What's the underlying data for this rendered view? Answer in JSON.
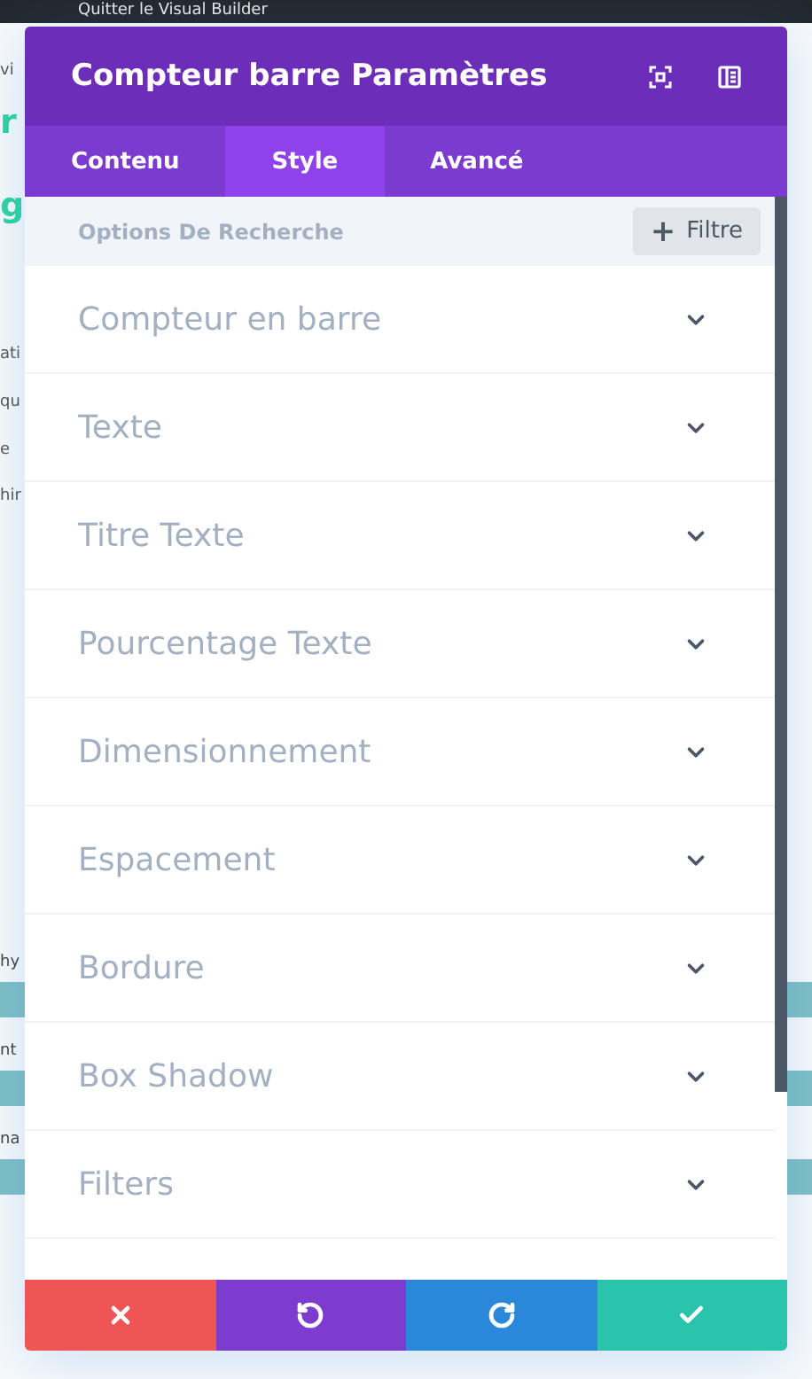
{
  "top_bar": {
    "label": "Quitter le Visual Builder"
  },
  "background": {
    "fragments": [
      {
        "text": "vi",
        "kind": "plain"
      },
      {
        "text": "r",
        "kind": "heading"
      },
      {
        "text": "g",
        "kind": "heading"
      },
      {
        "text": "ati",
        "kind": "plain"
      },
      {
        "text": "qu",
        "kind": "plain"
      },
      {
        "text": "e",
        "kind": "plain"
      },
      {
        "text": "hir",
        "kind": "plain"
      },
      {
        "text": "hy",
        "kind": "bar_label"
      },
      {
        "text": "nt",
        "kind": "bar_label"
      },
      {
        "text": "na",
        "kind": "bar_label"
      }
    ],
    "bars": [
      {
        "level": 1
      },
      {
        "level": 1
      },
      {
        "level": 1
      }
    ]
  },
  "panel": {
    "title": "Compteur barre Paramètres",
    "tabs": [
      {
        "label": "Contenu",
        "selected": false
      },
      {
        "label": "Style",
        "selected": true
      },
      {
        "label": "Avancé",
        "selected": false
      }
    ],
    "search": {
      "placeholder": "Options De Recherche"
    },
    "filter_button": {
      "icon": "+",
      "label": "Filtre"
    },
    "sections": [
      {
        "label": "Compteur en barre",
        "expanded": false
      },
      {
        "label": "Texte",
        "expanded": false
      },
      {
        "label": "Titre Texte",
        "expanded": false
      },
      {
        "label": "Pourcentage Texte",
        "expanded": false
      },
      {
        "label": "Dimensionnement",
        "expanded": false
      },
      {
        "label": "Espacement",
        "expanded": false
      },
      {
        "label": "Bordure",
        "expanded": false
      },
      {
        "label": "Box Shadow",
        "expanded": false
      },
      {
        "label": "Filters",
        "expanded": false
      }
    ],
    "footer": [
      {
        "kind": "cancel"
      },
      {
        "kind": "undo"
      },
      {
        "kind": "redo"
      },
      {
        "kind": "save"
      }
    ]
  }
}
